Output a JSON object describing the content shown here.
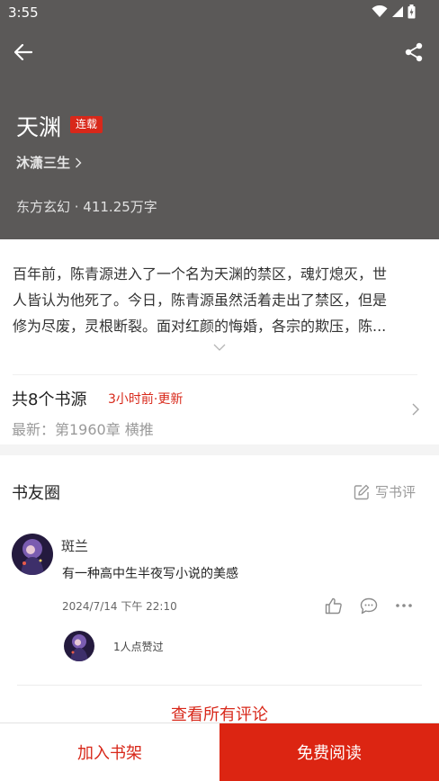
{
  "status_bar": {
    "time": "3:55"
  },
  "header": {
    "back_icon": "arrow-left-icon",
    "share_icon": "share-icon",
    "title": "天渊",
    "badge": "连载",
    "author": "沐潇三生",
    "meta": "东方玄幻 · 411.25万字",
    "background_color": "#5b5958"
  },
  "summary": {
    "lines": [
      "百年前，陈青源进入了一个名为天渊的禁区，魂灯熄灭，世",
      "人皆认为他死了。今日，陈青源虽然活着走出了禁区，但是",
      "修为尽废，灵根断裂。面对红颜的悔婚，各宗的欺压，陈..."
    ],
    "expand_icon": "chevron-down-icon"
  },
  "sources": {
    "count_label": "共8个书源",
    "updated": "3小时前·更新",
    "latest": "最新：第1960章 横推"
  },
  "circle": {
    "title": "书友圈",
    "write_review": "写书评",
    "comment": {
      "user": "斑兰",
      "text": "有一种高中生半夜写小说的美感",
      "time": "2024/7/14 下午 22:10",
      "likes": "1人点赞过"
    },
    "view_all": "查看所有评论"
  },
  "bottom_bar": {
    "add_to_shelf": "加入书架",
    "read_free": "免费阅读"
  },
  "colors": {
    "accent": "#d8281a",
    "header_bg": "#5b5958"
  }
}
